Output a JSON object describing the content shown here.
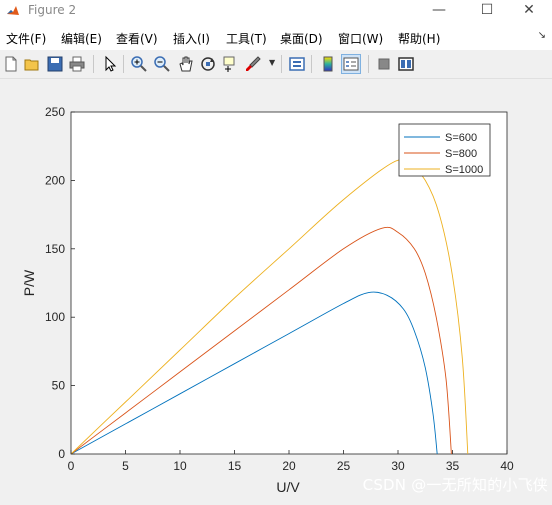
{
  "window": {
    "title": "Figure 2",
    "minimize_glyph": "—",
    "maximize_glyph": "☐",
    "close_glyph": "✕"
  },
  "menu": {
    "items": [
      "文件(F)",
      "编辑(E)",
      "查看(V)",
      "插入(I)",
      "工具(T)",
      "桌面(D)",
      "窗口(W)",
      "帮助(H)"
    ],
    "overflow_glyph": "↘"
  },
  "toolbar": {
    "icons": [
      "new-figure-icon",
      "open-file-icon",
      "save-icon",
      "print-icon",
      "pointer-icon",
      "zoom-in-icon",
      "zoom-out-icon",
      "pan-icon",
      "rotate-3d-icon",
      "data-cursor-icon",
      "brush-icon",
      "link-plot-icon",
      "colorbar-icon",
      "legend-icon",
      "hide-plot-tools-icon",
      "show-plot-tools-icon"
    ]
  },
  "watermark": "CSDN @一无所知的小飞侠",
  "colors": {
    "series1": "#0072bd",
    "series2": "#d95319",
    "series3": "#edb120",
    "axes_bg": "#ffffff",
    "figure_bg": "#f0f0f0"
  },
  "chart_data": {
    "type": "line",
    "xlabel": "U/V",
    "ylabel": "P/W",
    "xlim": [
      0,
      40
    ],
    "ylim": [
      0,
      250
    ],
    "xticks": [
      0,
      5,
      10,
      15,
      20,
      25,
      30,
      35,
      40
    ],
    "yticks": [
      0,
      50,
      100,
      150,
      200,
      250
    ],
    "grid": false,
    "legend_position": "top-right",
    "series": [
      {
        "name": "S=600",
        "color": "#0072bd",
        "x": [
          0,
          5,
          10,
          15,
          20,
          25,
          27.3,
          29,
          30.5,
          31.5,
          32.5,
          33.2,
          33.6
        ],
        "y": [
          0,
          22,
          44,
          66,
          88,
          110,
          118,
          116,
          106,
          90,
          63,
          30,
          0
        ]
      },
      {
        "name": "S=800",
        "color": "#d95319",
        "x": [
          0,
          5,
          10,
          15,
          20,
          25,
          28.5,
          30,
          31.5,
          32.5,
          33.5,
          34.4,
          34.9
        ],
        "y": [
          0,
          30,
          60,
          90,
          120,
          150,
          165,
          162,
          150,
          132,
          100,
          55,
          0
        ]
      },
      {
        "name": "S=1000",
        "color": "#edb120",
        "x": [
          0,
          5,
          10,
          15,
          20,
          25,
          29.5,
          31,
          32.5,
          33.8,
          35,
          35.9,
          36.4
        ],
        "y": [
          0,
          38,
          76,
          114,
          150,
          186,
          213,
          212,
          200,
          175,
          130,
          70,
          0
        ]
      }
    ]
  }
}
